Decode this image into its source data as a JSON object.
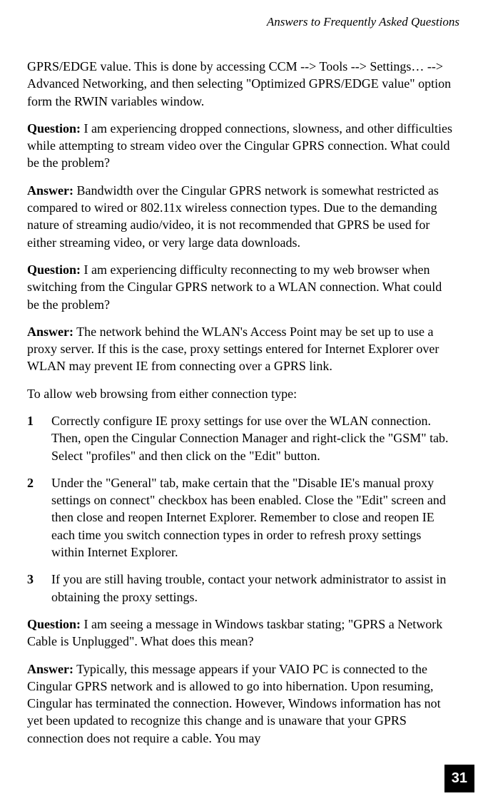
{
  "header": "Answers to Frequently Asked Questions",
  "intro": "GPRS/EDGE value. This is done by accessing CCM --> Tools --> Settings… --> Advanced Networking, and then selecting \"Optimized GPRS/EDGE value\" option form the RWIN variables window.",
  "q1_label": "Question:",
  "q1_text": " I am experiencing dropped connections, slowness, and other difficulties while attempting to stream video over the Cingular GPRS connection. What could be the problem?",
  "a1_label": "Answer:",
  "a1_text": " Bandwidth over the Cingular GPRS network is somewhat restricted as compared to wired or 802.11x wireless connection types. Due to the demanding nature of streaming audio/video, it is not recommended that GPRS be used for either streaming video, or very large data downloads.",
  "q2_label": "Question:",
  "q2_text": " I am experiencing difficulty reconnecting to my web browser when switching from the Cingular GPRS network to a WLAN connection. What could be the problem?",
  "a2_label": "Answer:",
  "a2_text": " The network behind the WLAN's Access Point may be set up to use a proxy server. If this is the case, proxy settings entered for Internet Explorer over WLAN may prevent IE from connecting over a GPRS link.",
  "instructions_intro": "To allow web browsing from either connection type:",
  "steps": [
    {
      "num": "1",
      "text": "Correctly configure IE proxy settings for use over the WLAN connection. Then, open the Cingular Connection Manager and right-click the \"GSM\" tab. Select \"profiles\" and then click on the \"Edit\" button."
    },
    {
      "num": "2",
      "text": "Under the \"General\" tab, make certain that the \"Disable IE's manual proxy settings on connect\" checkbox has been enabled. Close the \"Edit\" screen and then close and reopen Internet Explorer. Remember to close and reopen IE each time you switch connection types in order to refresh proxy settings within Internet Explorer."
    },
    {
      "num": "3",
      "text": "If you are still having trouble, contact your network administrator to assist in obtaining the proxy settings."
    }
  ],
  "q3_label": "Question:",
  "q3_text": " I am seeing a message in Windows taskbar stating; \"GPRS a Network Cable is Unplugged\". What does this mean?",
  "a3_label": "Answer:",
  "a3_text": " Typically, this message appears if your VAIO PC is connected to the Cingular GPRS network and is allowed to go into hibernation. Upon resuming, Cingular has terminated the connection. However, Windows information has not yet been updated to recognize this change and is unaware that your GPRS connection does not require a cable. You may",
  "page_number": "31"
}
